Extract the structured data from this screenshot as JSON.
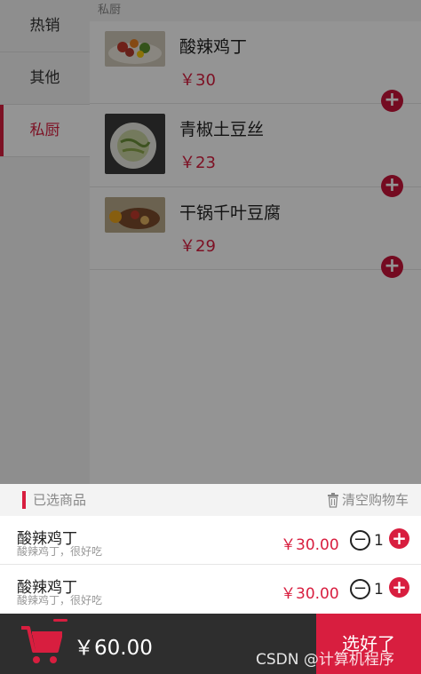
{
  "sidebar": {
    "categories": [
      {
        "label": "热销"
      },
      {
        "label": "其他"
      },
      {
        "label": "私厨"
      }
    ]
  },
  "menu": {
    "section_title": "私厨",
    "items": [
      {
        "name": "酸辣鸡丁",
        "price": "￥30"
      },
      {
        "name": "青椒土豆丝",
        "price": "￥23"
      },
      {
        "name": "干锅千叶豆腐",
        "price": "￥29"
      }
    ]
  },
  "cart": {
    "title": "已选商品",
    "clear_label": "清空购物车",
    "items": [
      {
        "name": "酸辣鸡丁",
        "desc": "酸辣鸡丁，很好吃",
        "price": "￥30.00",
        "qty": "1"
      },
      {
        "name": "酸辣鸡丁",
        "desc": "酸辣鸡丁，很好吃",
        "price": "￥30.00",
        "qty": "1"
      }
    ]
  },
  "bottom": {
    "total": "￥60.00",
    "confirm_label": "选好了"
  },
  "watermark": "CSDN @计算机程序",
  "colors": {
    "accent": "#d81e3f",
    "bottom_bar": "#2e2e2e"
  },
  "icons": [
    "plus-icon",
    "minus-icon",
    "trash-icon",
    "shopping-cart-icon"
  ]
}
